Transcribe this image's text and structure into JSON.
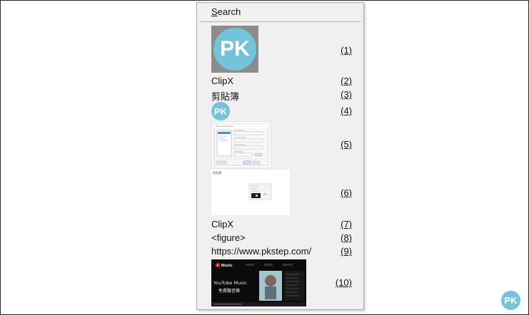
{
  "menu": {
    "search_label": "Search",
    "search_mnemonic": "S",
    "search_rest": "earch",
    "items": [
      {
        "type": "image",
        "image": "pk-logo",
        "shortcut": "(1)"
      },
      {
        "type": "text",
        "text": "ClipX",
        "shortcut": "(2)"
      },
      {
        "type": "text",
        "text": "剪貼簿",
        "shortcut": "(3)"
      },
      {
        "type": "image",
        "image": "pk-logo-small",
        "shortcut": "(4)"
      },
      {
        "type": "image",
        "image": "dialog-screenshot",
        "shortcut": "(5)"
      },
      {
        "type": "image",
        "image": "clipboard-screenshot",
        "shortcut": "(6)"
      },
      {
        "type": "text",
        "text": "ClipX",
        "shortcut": "(7)"
      },
      {
        "type": "text",
        "text": "<figure>",
        "shortcut": "(8)"
      },
      {
        "type": "text",
        "text": "https://www.pkstep.com/",
        "shortcut": "(9)"
      },
      {
        "type": "image",
        "image": "youtube-music-screenshot",
        "shortcut": "(10)"
      }
    ]
  },
  "logo_text": "PK",
  "youtube_thumb": {
    "brand": "Music",
    "title": "YouTube Music",
    "subtitle": "免費聽音樂"
  },
  "clip_thumb_label": "剪貼簿",
  "colors": {
    "menu_bg": "#f0f0f0",
    "logo_blue": "#72c4db",
    "logo_gray": "#8c8c8c"
  }
}
